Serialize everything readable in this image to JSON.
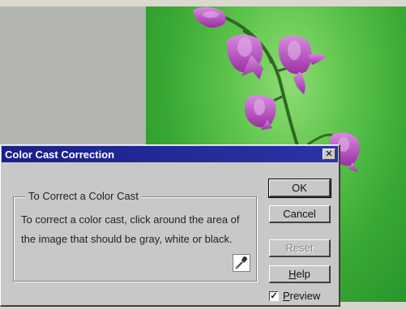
{
  "dialog": {
    "title": "Color Cast Correction",
    "close_glyph": "✕",
    "group_title": "To Correct a Color Cast",
    "description_lines": [
      "To correct a color cast, click around the area of",
      "the image that should be gray, white or black."
    ],
    "eyedropper_icon": "eyedropper-icon",
    "buttons": {
      "ok": "OK",
      "cancel": "Cancel",
      "reset": "Reset",
      "help_prefix": "",
      "help_underline": "H",
      "help_rest": "elp"
    },
    "preview": {
      "checked": true,
      "check_glyph": "✓",
      "underline": "P",
      "rest": "review"
    }
  },
  "colors": {
    "titlebar": "#1a1f8a",
    "dialog_bg": "#c8c8c8",
    "photo_green": "#3aa834",
    "flower_purple": "#b04bb8"
  }
}
